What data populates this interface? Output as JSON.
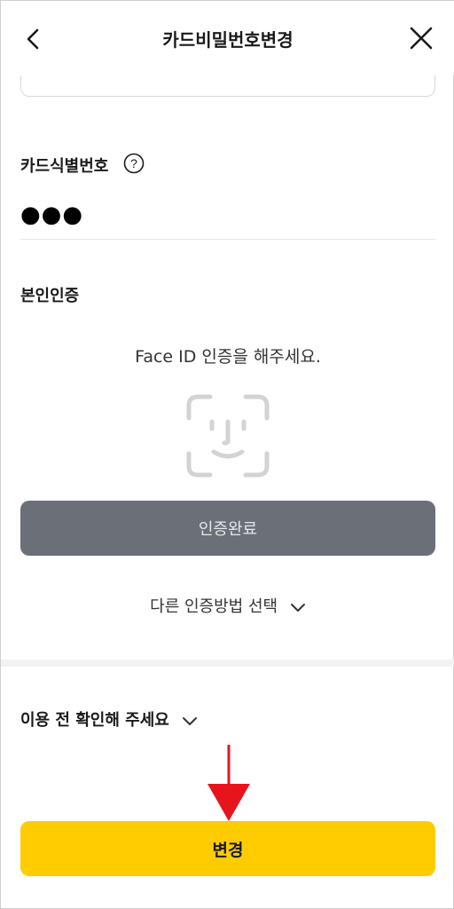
{
  "header": {
    "title": "카드비밀번호변경"
  },
  "card_id": {
    "label": "카드식별번호",
    "masked_value": "●●●"
  },
  "identity": {
    "label": "본인인증",
    "face_message": "Face ID 인증을 해주세요.",
    "complete_label": "인증완료",
    "other_method_label": "다른 인증방법 선택"
  },
  "notice": {
    "label": "이용 전 확인해 주세요"
  },
  "footer": {
    "change_label": "변경"
  },
  "colors": {
    "accent_yellow": "#fecc00",
    "disabled_gray": "#6b6f78",
    "annotation_red": "#e8141c"
  },
  "icons": [
    "back-icon",
    "close-icon",
    "help-icon",
    "faceid-icon",
    "chevron-down-icon",
    "arrow-annotation"
  ]
}
